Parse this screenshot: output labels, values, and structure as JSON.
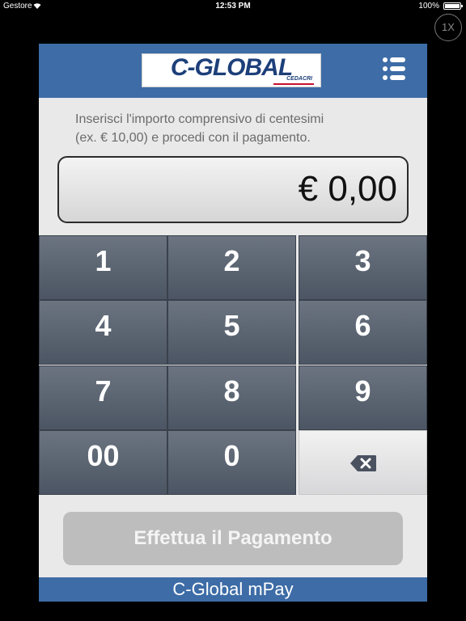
{
  "status_bar": {
    "carrier": "Gestore",
    "time": "12:53 PM",
    "battery": "100%",
    "battery_level": 1.0
  },
  "zoom_badge": "1X",
  "header": {
    "logo_text": "C-GLOBAL",
    "logo_subtext": "CEDACRI",
    "menu_icon": "list-icon"
  },
  "instructions": {
    "line1": "Inserisci l'importo comprensivo di centesimi",
    "line2": "(ex. € 10,00) e procedi con il pagamento."
  },
  "amount": {
    "value": "€ 0,00"
  },
  "keypad": {
    "keys": [
      "1",
      "2",
      "3",
      "4",
      "5",
      "6",
      "7",
      "8",
      "9",
      "00",
      "0"
    ],
    "backspace_icon": "backspace-icon"
  },
  "pay_button": {
    "label": "Effettua il Pagamento"
  },
  "footer": {
    "title": "C-Global mPay"
  },
  "colors": {
    "brand_blue": "#3d6ca6",
    "key_dark": "#566070",
    "button_disabled": "#bdbdbd"
  }
}
